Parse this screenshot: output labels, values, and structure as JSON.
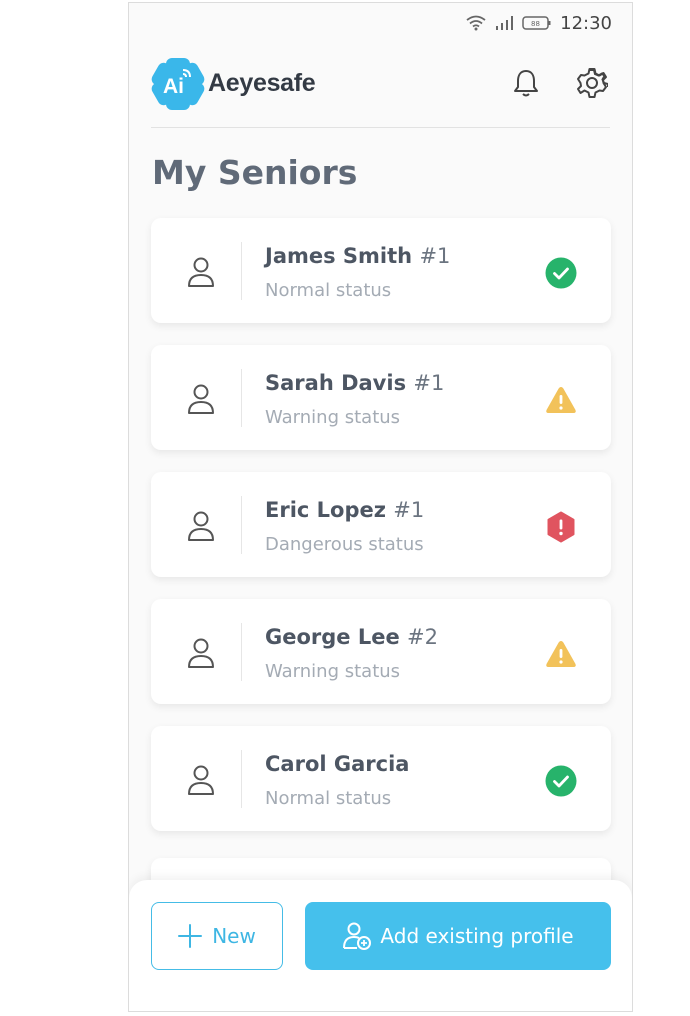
{
  "status_bar": {
    "time": "12:30",
    "battery_level": "88"
  },
  "header": {
    "brand": "Aeyesafe",
    "logo_text": "Ai"
  },
  "page_title": "My Seniors",
  "seniors": [
    {
      "name": "James Smith",
      "number": "#1",
      "status": "Normal status",
      "level": "normal",
      "icon": "check-icon"
    },
    {
      "name": "Sarah Davis",
      "number": "#1",
      "status": "Warning status",
      "level": "warning",
      "icon": "warning-triangle-icon"
    },
    {
      "name": "Eric Lopez",
      "number": "#1",
      "status": "Dangerous status",
      "level": "danger",
      "icon": "danger-hexagon-icon"
    },
    {
      "name": "George Lee",
      "number": "#2",
      "status": "Warning status",
      "level": "warning",
      "icon": "warning-triangle-icon"
    },
    {
      "name": "Carol Garcia",
      "number": "",
      "status": "Normal status",
      "level": "normal",
      "icon": "check-icon"
    }
  ],
  "actions": {
    "new_label": "New",
    "add_existing_label": "Add existing profile"
  },
  "colors": {
    "accent": "#45c0ec",
    "normal": "#27b36b",
    "warning": "#f2c25a",
    "danger": "#e0545f",
    "logo": "#3ab7ea"
  }
}
